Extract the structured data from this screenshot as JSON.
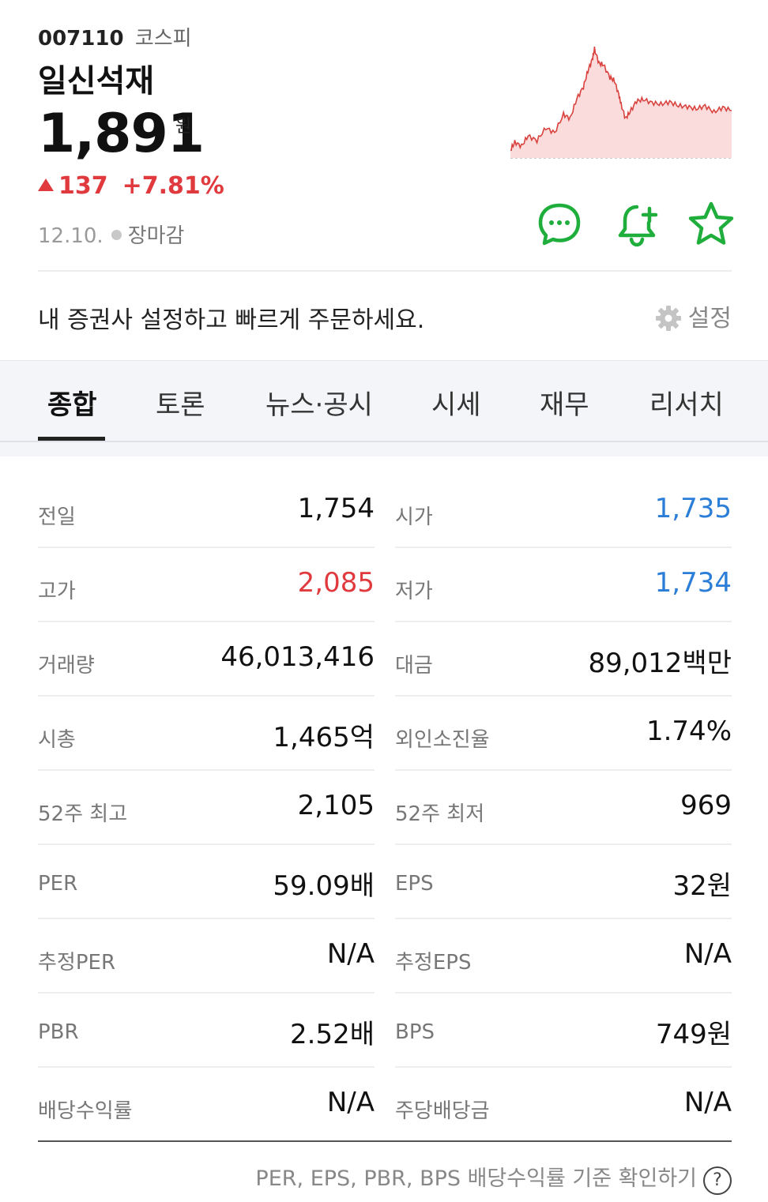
{
  "stock": {
    "code": "007110",
    "market": "코스피",
    "name": "일신석재",
    "price": "1,891",
    "unit": "원",
    "change": "137",
    "change_pct": "+7.81%",
    "date": "12.10.",
    "status": "장마감"
  },
  "broker": {
    "text": "내 증권사 설정하고 빠르게 주문하세요.",
    "settings_label": "설정"
  },
  "tabs": [
    {
      "label": "종합",
      "active": true
    },
    {
      "label": "토론"
    },
    {
      "label": "뉴스·공시"
    },
    {
      "label": "시세"
    },
    {
      "label": "재무"
    },
    {
      "label": "리서치"
    }
  ],
  "info_rows": [
    [
      {
        "label": "전일",
        "value": "1,754"
      },
      {
        "label": "시가",
        "value": "1,735",
        "tone": "down"
      }
    ],
    [
      {
        "label": "고가",
        "value": "2,085",
        "tone": "up"
      },
      {
        "label": "저가",
        "value": "1,734",
        "tone": "down"
      }
    ],
    [
      {
        "label": "거래량",
        "value": "46,013,416"
      },
      {
        "label": "대금",
        "value": "89,012백만"
      }
    ],
    [
      {
        "label": "시총",
        "value": "1,465억"
      },
      {
        "label": "외인소진율",
        "value": "1.74%"
      }
    ],
    [
      {
        "label": "52주 최고",
        "value": "2,105"
      },
      {
        "label": "52주 최저",
        "value": "969"
      }
    ],
    [
      {
        "label": "PER",
        "value": "59.09배"
      },
      {
        "label": "EPS",
        "value": "32원"
      }
    ],
    [
      {
        "label": "추정PER",
        "value": "N/A"
      },
      {
        "label": "추정EPS",
        "value": "N/A"
      }
    ],
    [
      {
        "label": "PBR",
        "value": "2.52배"
      },
      {
        "label": "BPS",
        "value": "749원"
      }
    ],
    [
      {
        "label": "배당수익률",
        "value": "N/A"
      },
      {
        "label": "주당배당금",
        "value": "N/A"
      }
    ]
  ],
  "footer": {
    "text": "PER, EPS, PBR, BPS 배당수익률 기준 확인하기",
    "help": "?"
  },
  "colors": {
    "up": "#e03a3e",
    "down": "#2a7ed8",
    "action_green": "#1fae3c"
  },
  "icons": [
    "chat-icon",
    "bell-plus-icon",
    "star-icon",
    "gear-icon",
    "help-icon"
  ]
}
